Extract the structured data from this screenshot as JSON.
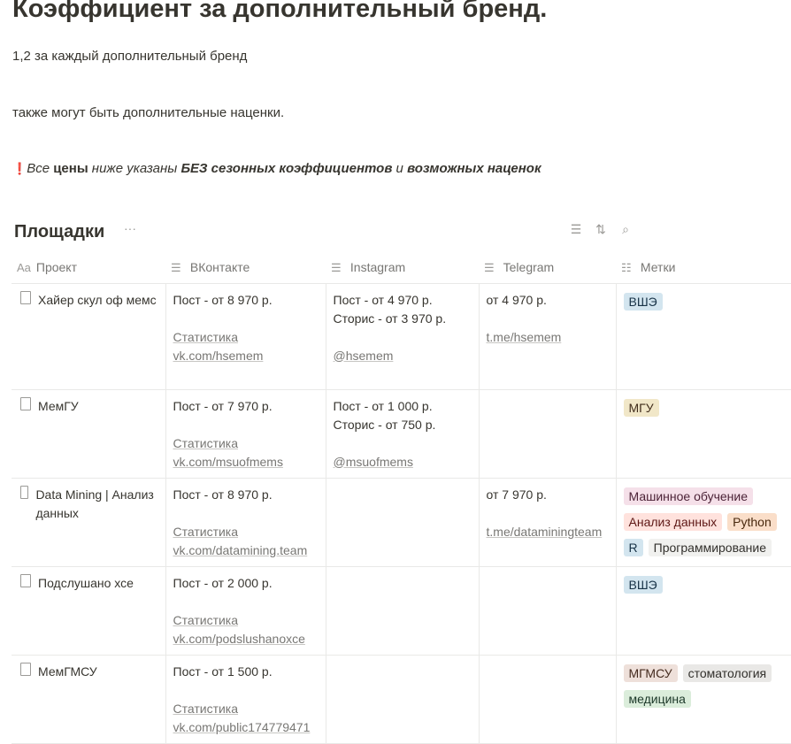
{
  "page": {
    "title": "Коэффициент за дополнительный бренд.",
    "line1": "1,2 за каждый дополнительный бренд",
    "line2": "также могут быть дополнительные наценки.",
    "note": {
      "icon": "❗",
      "a": "Все ",
      "b": "цены",
      "c": " ниже указаны ",
      "d": "БЕЗ сезонных коэффициентов",
      "e": " и ",
      "f": "возможных наценок"
    }
  },
  "db": {
    "title": "Площадки",
    "more": "···",
    "filter": "☰",
    "sort": "⇅",
    "search": "⌕",
    "columns": [
      {
        "icon": "Aa",
        "label": "Проект"
      },
      {
        "icon": "☰",
        "label": "ВКонтакте"
      },
      {
        "icon": "☰",
        "label": "Instagram"
      },
      {
        "icon": "☰",
        "label": "Telegram"
      },
      {
        "icon": "☷",
        "label": "Метки"
      }
    ],
    "rows": [
      {
        "name": "Хайер скул оф мемс",
        "vk": [
          "Пост - от 8 970 р.",
          ""
        ],
        "vk_links": [
          "Статистика",
          "vk.com/hsemem"
        ],
        "ig": [
          "Пост - от 4 970 р.",
          "Сторис - от 3 970 р.",
          ""
        ],
        "ig_links": [
          "@hsemem"
        ],
        "tg": [
          "от 4 970 р.",
          ""
        ],
        "tg_links": [
          "t.me/hsemem"
        ],
        "tags": [
          {
            "t": "ВШЭ",
            "c": "blue"
          }
        ],
        "h": 120
      },
      {
        "name": "МемГУ",
        "vk": [
          "Пост - от 7 970 р.",
          ""
        ],
        "vk_links": [
          "Статистика",
          "vk.com/msuofmems"
        ],
        "ig": [
          "Пост - от 1 000 р.",
          "Сторис - от 750 р.",
          ""
        ],
        "ig_links": [
          "@msuofmems"
        ],
        "tg": [],
        "tg_links": [],
        "tags": [
          {
            "t": "МГУ",
            "c": "yellow"
          }
        ],
        "h": 100
      },
      {
        "name": "Data Mining | Анализ данных",
        "vk": [
          "Пост - от 8 970 р.",
          ""
        ],
        "vk_links": [
          "Статистика",
          "vk.com/datamining.team"
        ],
        "ig": [],
        "ig_links": [],
        "tg": [
          "от 7 970 р.",
          ""
        ],
        "tg_links": [
          "t.me/dataminingteam"
        ],
        "tags": [
          {
            "t": "Машинное обучение",
            "c": "pink"
          },
          {
            "t": "Анализ данных",
            "c": "red"
          },
          {
            "t": "Python",
            "c": "orange"
          },
          {
            "t": "R",
            "c": "blue"
          },
          {
            "t": "Программирование",
            "c": "lightgray"
          }
        ],
        "h": 100
      },
      {
        "name": "Подслушано хсе",
        "vk": [
          "Пост - от 2 000 р.",
          ""
        ],
        "vk_links": [
          "Статистика",
          "vk.com/podslushanoxce"
        ],
        "ig": [],
        "ig_links": [],
        "tg": [],
        "tg_links": [],
        "tags": [
          {
            "t": "ВШЭ",
            "c": "blue"
          }
        ],
        "h": 100
      },
      {
        "name": " МемГМСУ",
        "vk": [
          "Пост - от 1 500 р.",
          ""
        ],
        "vk_links": [
          "Статистика",
          "vk.com/public174779471"
        ],
        "ig": [],
        "ig_links": [],
        "tg": [],
        "tg_links": [],
        "tags": [
          {
            "t": "МГМСУ",
            "c": "brown"
          },
          {
            "t": "стоматология",
            "c": "gray"
          },
          {
            "t": "медицина",
            "c": "green"
          }
        ],
        "h": 100
      }
    ]
  },
  "colors": {
    "blue": [
      "#d3e5ef",
      "#183347"
    ],
    "yellow": [
      "#f1e7c8",
      "#402c1b"
    ],
    "pink": [
      "#f5e0e9",
      "#4c2337"
    ],
    "red": [
      "#ffe2dd",
      "#5d1715"
    ],
    "orange": [
      "#fadec9",
      "#49290e"
    ],
    "lightgray": [
      "#f1f1ef",
      "#32302c"
    ],
    "gray": [
      "#e9e8e6",
      "#32302c"
    ],
    "brown": [
      "#eee0da",
      "#442a1e"
    ],
    "green": [
      "#dbeddb",
      "#1c3829"
    ]
  }
}
